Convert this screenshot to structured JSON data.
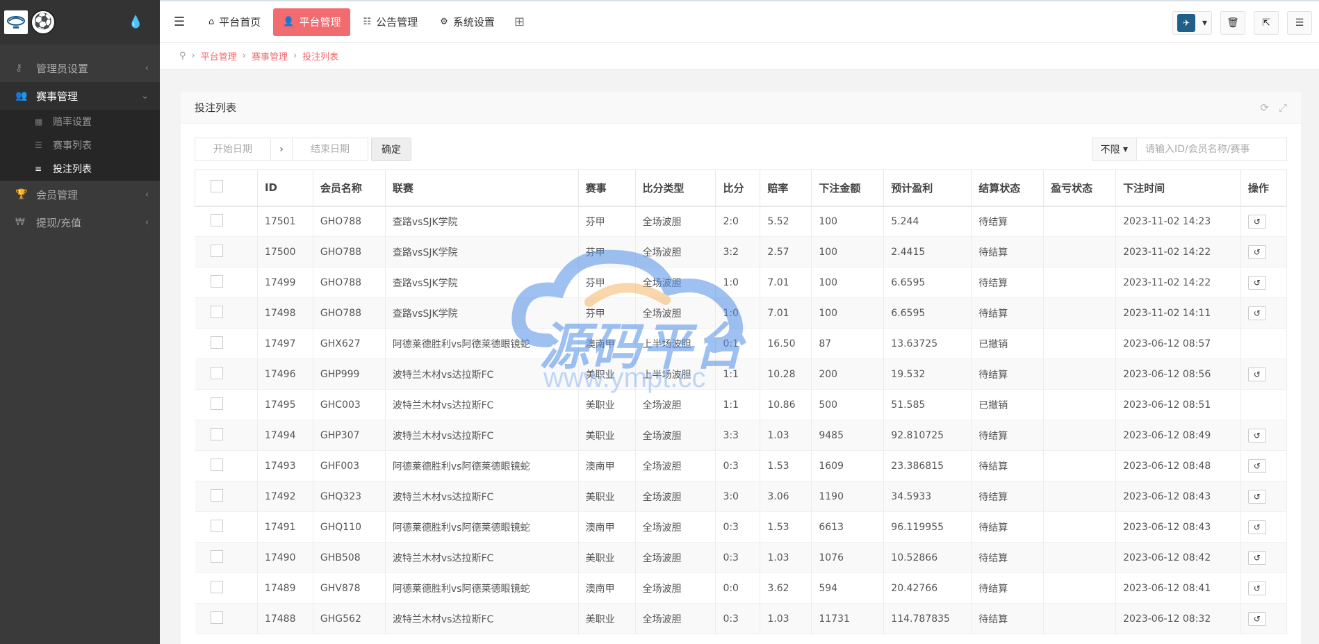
{
  "sidebar": {
    "items": [
      {
        "label": "管理员设置",
        "icon": "key-icon",
        "arrow": "‹"
      },
      {
        "label": "赛事管理",
        "icon": "users-icon",
        "arrow": "⌄"
      },
      {
        "label": "会员管理",
        "icon": "trophy-icon",
        "arrow": "‹"
      },
      {
        "label": "提现/充值",
        "icon": "won-icon",
        "arrow": "‹"
      }
    ],
    "subitems": [
      {
        "label": "赔率设置"
      },
      {
        "label": "赛事列表"
      },
      {
        "label": "投注列表"
      }
    ]
  },
  "topbar": {
    "tabs": [
      {
        "label": "平台首页",
        "icon": "home-icon"
      },
      {
        "label": "平台管理",
        "icon": "user-icon"
      },
      {
        "label": "公告管理",
        "icon": "list-icon"
      },
      {
        "label": "系统设置",
        "icon": "gear-icon"
      }
    ]
  },
  "breadcrumb": [
    "平台管理",
    "赛事管理",
    "投注列表"
  ],
  "panel": {
    "title": "投注列表",
    "start_date_placeholder": "开始日期",
    "end_date_placeholder": "结束日期",
    "confirm_label": "确定",
    "filter_select": "不限",
    "search_placeholder": "请输入ID/会员名称/赛事"
  },
  "table": {
    "columns": [
      "ID",
      "会员名称",
      "联赛",
      "赛事",
      "比分类型",
      "比分",
      "赔率",
      "下注金额",
      "预计盈利",
      "结算状态",
      "盈亏状态",
      "下注时间",
      "操作"
    ],
    "rows": [
      {
        "id": "17501",
        "member": "GHO788",
        "league": "查路vsSJK学院",
        "match": "芬甲",
        "type": "全场波胆",
        "score": "2:0",
        "odds": "5.52",
        "amount": "100",
        "profit": "5.244",
        "status": "待结算",
        "pl": "",
        "time": "2023-11-02 14:23",
        "undo": true
      },
      {
        "id": "17500",
        "member": "GHO788",
        "league": "查路vsSJK学院",
        "match": "芬甲",
        "type": "全场波胆",
        "score": "3:2",
        "odds": "2.57",
        "amount": "100",
        "profit": "2.4415",
        "status": "待结算",
        "pl": "",
        "time": "2023-11-02 14:22",
        "undo": true
      },
      {
        "id": "17499",
        "member": "GHO788",
        "league": "查路vsSJK学院",
        "match": "芬甲",
        "type": "全场波胆",
        "score": "1:0",
        "odds": "7.01",
        "amount": "100",
        "profit": "6.6595",
        "status": "待结算",
        "pl": "",
        "time": "2023-11-02 14:22",
        "undo": true
      },
      {
        "id": "17498",
        "member": "GHO788",
        "league": "查路vsSJK学院",
        "match": "芬甲",
        "type": "全场波胆",
        "score": "1:0",
        "odds": "7.01",
        "amount": "100",
        "profit": "6.6595",
        "status": "待结算",
        "pl": "",
        "time": "2023-11-02 14:11",
        "undo": true
      },
      {
        "id": "17497",
        "member": "GHX627",
        "league": "阿德莱德胜利vs阿德莱德眼镜蛇",
        "match": "澳南甲",
        "type": "上半场波胆",
        "score": "0:1",
        "odds": "16.50",
        "amount": "87",
        "profit": "13.63725",
        "status": "已撤销",
        "pl": "",
        "time": "2023-06-12 08:57",
        "undo": false
      },
      {
        "id": "17496",
        "member": "GHP999",
        "league": "波特兰木材vs达拉斯FC",
        "match": "美职业",
        "type": "上半场波胆",
        "score": "1:1",
        "odds": "10.28",
        "amount": "200",
        "profit": "19.532",
        "status": "待结算",
        "pl": "",
        "time": "2023-06-12 08:56",
        "undo": true
      },
      {
        "id": "17495",
        "member": "GHC003",
        "league": "波特兰木材vs达拉斯FC",
        "match": "美职业",
        "type": "全场波胆",
        "score": "1:1",
        "odds": "10.86",
        "amount": "500",
        "profit": "51.585",
        "status": "已撤销",
        "pl": "",
        "time": "2023-06-12 08:51",
        "undo": false
      },
      {
        "id": "17494",
        "member": "GHP307",
        "league": "波特兰木材vs达拉斯FC",
        "match": "美职业",
        "type": "全场波胆",
        "score": "3:3",
        "odds": "1.03",
        "amount": "9485",
        "profit": "92.810725",
        "status": "待结算",
        "pl": "",
        "time": "2023-06-12 08:49",
        "undo": true
      },
      {
        "id": "17493",
        "member": "GHF003",
        "league": "阿德莱德胜利vs阿德莱德眼镜蛇",
        "match": "澳南甲",
        "type": "全场波胆",
        "score": "0:3",
        "odds": "1.53",
        "amount": "1609",
        "profit": "23.386815",
        "status": "待结算",
        "pl": "",
        "time": "2023-06-12 08:48",
        "undo": true
      },
      {
        "id": "17492",
        "member": "GHQ323",
        "league": "波特兰木材vs达拉斯FC",
        "match": "美职业",
        "type": "全场波胆",
        "score": "3:0",
        "odds": "3.06",
        "amount": "1190",
        "profit": "34.5933",
        "status": "待结算",
        "pl": "",
        "time": "2023-06-12 08:43",
        "undo": true
      },
      {
        "id": "17491",
        "member": "GHQ110",
        "league": "阿德莱德胜利vs阿德莱德眼镜蛇",
        "match": "澳南甲",
        "type": "全场波胆",
        "score": "0:3",
        "odds": "1.53",
        "amount": "6613",
        "profit": "96.119955",
        "status": "待结算",
        "pl": "",
        "time": "2023-06-12 08:43",
        "undo": true
      },
      {
        "id": "17490",
        "member": "GHB508",
        "league": "波特兰木材vs达拉斯FC",
        "match": "美职业",
        "type": "全场波胆",
        "score": "0:3",
        "odds": "1.03",
        "amount": "1076",
        "profit": "10.52866",
        "status": "待结算",
        "pl": "",
        "time": "2023-06-12 08:42",
        "undo": true
      },
      {
        "id": "17489",
        "member": "GHV878",
        "league": "阿德莱德胜利vs阿德莱德眼镜蛇",
        "match": "澳南甲",
        "type": "全场波胆",
        "score": "0:0",
        "odds": "3.62",
        "amount": "594",
        "profit": "20.42766",
        "status": "待结算",
        "pl": "",
        "time": "2023-06-12 08:41",
        "undo": true
      },
      {
        "id": "17488",
        "member": "GHG562",
        "league": "波特兰木材vs达拉斯FC",
        "match": "美职业",
        "type": "全场波胆",
        "score": "0:3",
        "odds": "1.03",
        "amount": "11731",
        "profit": "114.787835",
        "status": "待结算",
        "pl": "",
        "time": "2023-06-12 08:32",
        "undo": true
      }
    ]
  },
  "watermark": {
    "title": "源码平台",
    "url": "www.ympt.cc"
  },
  "colors": {
    "accent": "#f16b6f",
    "sidebar": "#3a3a3a"
  }
}
